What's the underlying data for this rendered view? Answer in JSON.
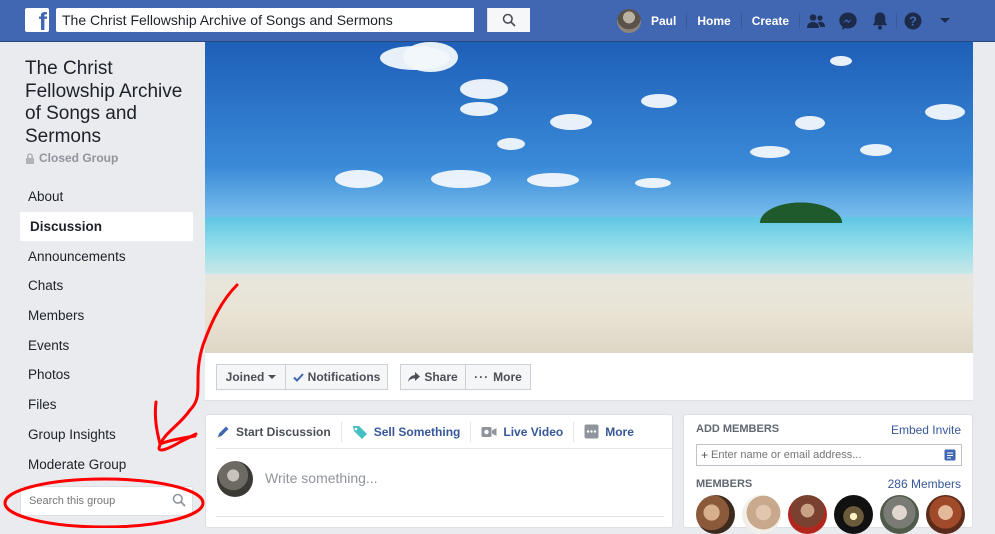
{
  "topbar": {
    "logo": "f",
    "search_value": "The Christ Fellowship Archive of Songs and Sermons",
    "user_name": "Paul",
    "home": "Home",
    "create": "Create",
    "icons": [
      "search-icon",
      "friends-icon",
      "messenger-icon",
      "notifications-icon",
      "help-icon",
      "caret-down-icon"
    ],
    "brand_color": "#4267b2"
  },
  "sidebar": {
    "group_title": "The Christ Fellowship Archive of Songs and Sermons",
    "privacy": "Closed Group",
    "items": [
      {
        "label": "About"
      },
      {
        "label": "Discussion"
      },
      {
        "label": "Announcements"
      },
      {
        "label": "Chats"
      },
      {
        "label": "Members"
      },
      {
        "label": "Events"
      },
      {
        "label": "Photos"
      },
      {
        "label": "Files"
      },
      {
        "label": "Group Insights"
      },
      {
        "label": "Moderate Group"
      }
    ],
    "active_item": "Discussion",
    "search_placeholder": "Search this group"
  },
  "action_bar": {
    "joined": "Joined",
    "notifications": "Notifications",
    "share": "Share",
    "more": "More"
  },
  "composer": {
    "tabs": [
      "Start Discussion",
      "Sell Something",
      "Live Video",
      "More"
    ],
    "placeholder": "Write something..."
  },
  "right_panel": {
    "add_members_title": "ADD MEMBERS",
    "embed_invite": "Embed Invite",
    "add_placeholder": "Enter name or email address...",
    "add_prefix": "+",
    "members_title": "MEMBERS",
    "members_count": "286 Members"
  },
  "annotation": {
    "color": "#ff0000"
  }
}
